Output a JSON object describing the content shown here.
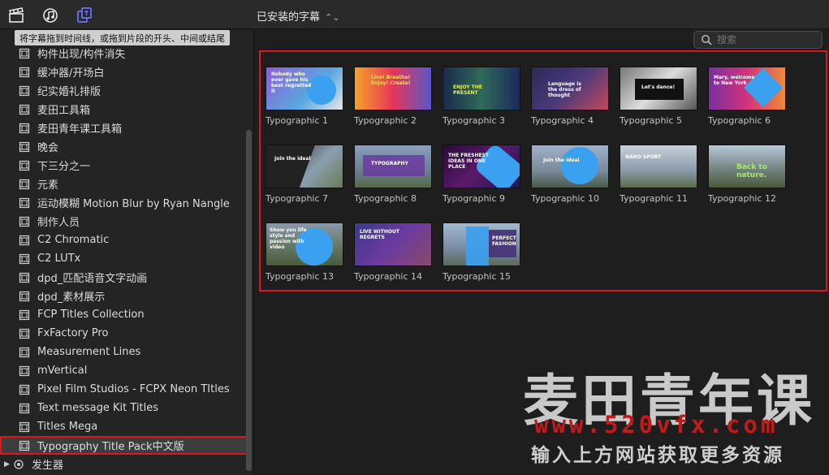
{
  "browser": {
    "title": "已安装的字幕",
    "chevron": "⌃⌄"
  },
  "tooltip": "将字幕拖到时间线，或拖到片段的开头、中间或结尾",
  "search": {
    "placeholder": "搜索"
  },
  "sidebar": {
    "items": [
      {
        "label": "构件出现/构件消失"
      },
      {
        "label": "缓冲器/开场白"
      },
      {
        "label": "纪实婚礼排版"
      },
      {
        "label": "麦田工具箱"
      },
      {
        "label": "麦田青年课工具箱"
      },
      {
        "label": "晚会"
      },
      {
        "label": "下三分之一"
      },
      {
        "label": "元素"
      },
      {
        "label": "运动模糊 Motion Blur by Ryan Nangle"
      },
      {
        "label": "制作人员"
      },
      {
        "label": "C2 Chromatic"
      },
      {
        "label": "C2 LUTx"
      },
      {
        "label": "dpd_匹配语音文字动画"
      },
      {
        "label": "dpd_素材展示"
      },
      {
        "label": "FCP Titles Collection"
      },
      {
        "label": "FxFactory Pro"
      },
      {
        "label": "Measurement Lines"
      },
      {
        "label": "mVertical"
      },
      {
        "label": "Pixel Film Studios - FCPX Neon TItles"
      },
      {
        "label": "Text message Kit Titles"
      },
      {
        "label": "Titles Mega"
      },
      {
        "label": "Typography Title Pack中文版",
        "selected": true
      }
    ],
    "generator": {
      "label": "发生器",
      "icon": "generator-icon"
    }
  },
  "tiles": [
    {
      "label": "Typographic 1",
      "text": "Nobody who ever gave his best regretted it"
    },
    {
      "label": "Typographic 2",
      "text": "Live! Breathe! Enjoy! Create!"
    },
    {
      "label": "Typographic 3",
      "text": "ENJOY THE PRESENT"
    },
    {
      "label": "Typographic 4",
      "text": "Language is the dress of thought"
    },
    {
      "label": "Typographic 5",
      "text": "Let's dance!"
    },
    {
      "label": "Typographic 6",
      "text": "Mary, welcome to New York"
    },
    {
      "label": "Typographic 7",
      "text": "Join the ideal"
    },
    {
      "label": "Typographic 8",
      "text": "TYPOGRAPHY"
    },
    {
      "label": "Typographic 9",
      "text": "THE FRESHEST IDEAS IN ONE PLACE"
    },
    {
      "label": "Typographic 10",
      "text": "Join the ideal"
    },
    {
      "label": "Typographic 11",
      "text": "NANO SPORT"
    },
    {
      "label": "Typographic 12",
      "text": "Back to nature."
    },
    {
      "label": "Typographic 13",
      "text": "Show you life style and passion with video"
    },
    {
      "label": "Typographic 14",
      "text": "LIVE WITHOUT REGRETS"
    },
    {
      "label": "Typographic 15",
      "text": "PERFECT FASHION"
    }
  ],
  "watermark": {
    "line1": "麦田青年课",
    "line2": "www.520vfx.com",
    "line3": "输入上方网站获取更多资源"
  },
  "colors": {
    "accent_red": "#e0141b",
    "circle_blue": "#3aa0f0"
  }
}
